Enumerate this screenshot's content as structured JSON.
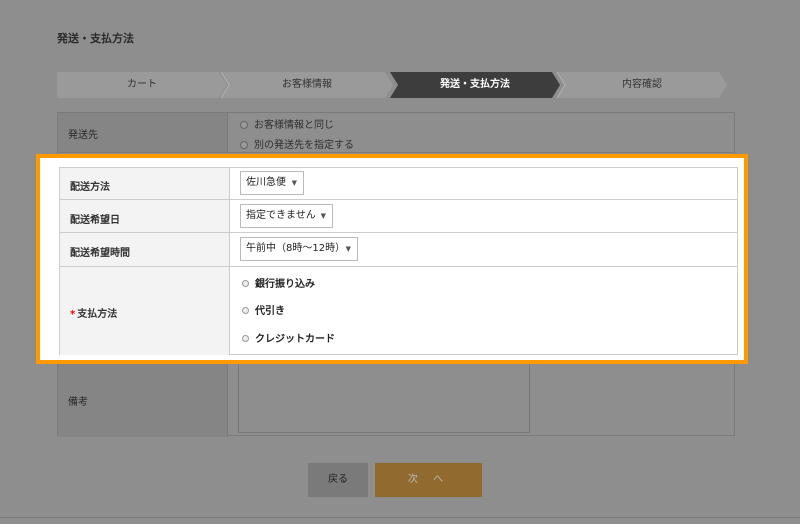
{
  "page_title": "発送・支払方法",
  "steps": [
    {
      "label": "カート",
      "active": false
    },
    {
      "label": "お客様情報",
      "active": false
    },
    {
      "label": "発送・支払方法",
      "active": true
    },
    {
      "label": "内容確認",
      "active": false
    }
  ],
  "shipping_to": {
    "label": "発送先",
    "options": [
      "お客様情報と同じ",
      "別の発送先を指定する"
    ],
    "selected": "お客様情報と同じ"
  },
  "delivery_method": {
    "label": "配送方法",
    "value": "佐川急便"
  },
  "delivery_date": {
    "label": "配送希望日",
    "value": "指定できません"
  },
  "delivery_time": {
    "label": "配送希望時間",
    "value": "午前中（8時～12時）"
  },
  "payment": {
    "required_mark": "*",
    "label": "支払方法",
    "options": [
      "銀行振り込み",
      "代引き",
      "クレジットカード"
    ]
  },
  "notes": {
    "label": "備考",
    "value": ""
  },
  "buttons": {
    "back": "戻る",
    "next": "次 へ"
  },
  "colors": {
    "highlight": "#ff9900",
    "next_button": "#f0a030",
    "active_step": "#555555"
  }
}
